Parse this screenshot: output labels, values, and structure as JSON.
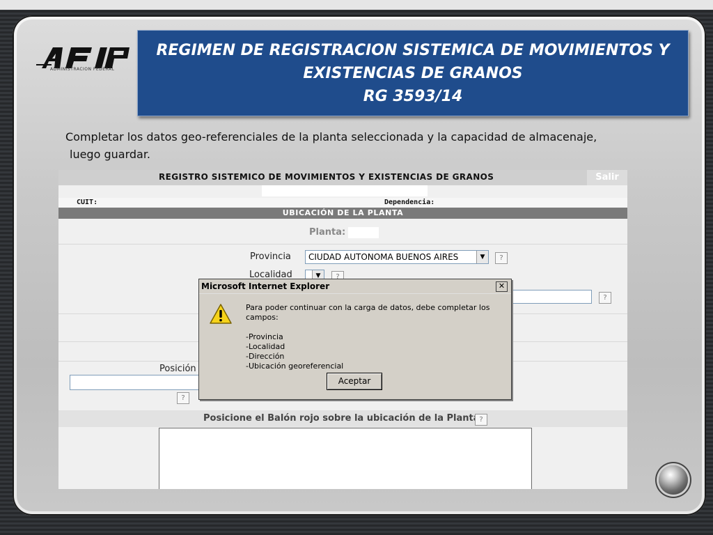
{
  "slide": {
    "logo_text": "AFIP",
    "logo_subtitle": "ADMINISTRACION FEDERAL",
    "title_lines": [
      "REGIMEN DE REGISTRACION SISTEMICA DE MOVIMIENTOS Y",
      "EXISTENCIAS DE GRANOS",
      "RG  3593/14"
    ],
    "instruction_line1": "Completar los datos geo-referenciales de la planta seleccionada y la capacidad de almacenaje,",
    "instruction_line2": "luego guardar."
  },
  "app": {
    "header_title": "REGISTRO SISTEMICO DE MOVIMIENTOS Y EXISTENCIAS DE GRANOS",
    "salir_label": "Salir",
    "cuit_label": "CUIT:",
    "dependencia_label": "Dependencia:",
    "section_title": "UBICACIÓN DE LA PLANTA",
    "planta_label": "Planta:",
    "provincia_label": "Provincia",
    "provincia_value": "CIUDAD AUTONOMA BUENOS AIRES",
    "localidad_label": "Localidad",
    "posicion_label": "Posición",
    "help_symbol": "?",
    "map_instruction": "Posicione el Balón rojo sobre la ubicación de la Planta"
  },
  "dialog": {
    "title": "Microsoft Internet Explorer",
    "close_symbol": "✕",
    "message": "Para poder continuar con la carga de datos, debe completar los campos:",
    "fields": [
      "-Provincia",
      "-Localidad",
      "-Dirección",
      "-Ubicación georeferencial"
    ],
    "ok_label": "Aceptar"
  },
  "colors": {
    "title_blue": "#1f4c8c",
    "section_gray": "#7a7a7a"
  }
}
